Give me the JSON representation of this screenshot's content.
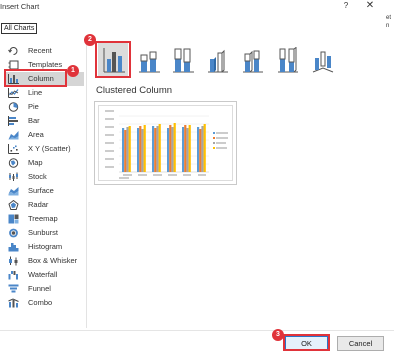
{
  "window": {
    "title": "Insert Chart",
    "help_label": "?",
    "close_label": "✕",
    "clipped_right_text": "et\nn"
  },
  "tabs": [
    {
      "label": "All Charts"
    }
  ],
  "sidebar": {
    "items": [
      {
        "label": "Recent",
        "icon": "recent-icon"
      },
      {
        "label": "Templates",
        "icon": "templates-icon"
      },
      {
        "label": "Column",
        "icon": "column-chart-icon",
        "selected": true
      },
      {
        "label": "Line",
        "icon": "line-chart-icon"
      },
      {
        "label": "Pie",
        "icon": "pie-chart-icon"
      },
      {
        "label": "Bar",
        "icon": "bar-chart-icon"
      },
      {
        "label": "Area",
        "icon": "area-chart-icon"
      },
      {
        "label": "X Y (Scatter)",
        "icon": "scatter-chart-icon"
      },
      {
        "label": "Map",
        "icon": "map-chart-icon"
      },
      {
        "label": "Stock",
        "icon": "stock-chart-icon"
      },
      {
        "label": "Surface",
        "icon": "surface-chart-icon"
      },
      {
        "label": "Radar",
        "icon": "radar-chart-icon"
      },
      {
        "label": "Treemap",
        "icon": "treemap-chart-icon"
      },
      {
        "label": "Sunburst",
        "icon": "sunburst-chart-icon"
      },
      {
        "label": "Histogram",
        "icon": "histogram-chart-icon"
      },
      {
        "label": "Box & Whisker",
        "icon": "box-whisker-chart-icon"
      },
      {
        "label": "Waterfall",
        "icon": "waterfall-chart-icon"
      },
      {
        "label": "Funnel",
        "icon": "funnel-chart-icon"
      },
      {
        "label": "Combo",
        "icon": "combo-chart-icon"
      }
    ]
  },
  "chart_types": [
    {
      "icon": "clustered-column-icon",
      "selected": true
    },
    {
      "icon": "stacked-column-icon"
    },
    {
      "icon": "100-stacked-column-icon"
    },
    {
      "icon": "3d-clustered-column-icon"
    },
    {
      "icon": "3d-stacked-column-icon"
    },
    {
      "icon": "3d-100-stacked-column-icon"
    },
    {
      "icon": "3d-column-icon"
    }
  ],
  "preview": {
    "title": "Clustered Column"
  },
  "annotations": {
    "badge1": "1",
    "badge2": "2",
    "badge3": "3"
  },
  "buttons": {
    "ok": "OK",
    "cancel": "Cancel"
  },
  "colors": {
    "highlight": "#e0333a",
    "selected_bg": "#d5d5d5",
    "series": [
      "#5b9bd5",
      "#ed7d31",
      "#a5a5a5",
      "#ffc000"
    ],
    "icon_blue": "#4a86c8"
  }
}
